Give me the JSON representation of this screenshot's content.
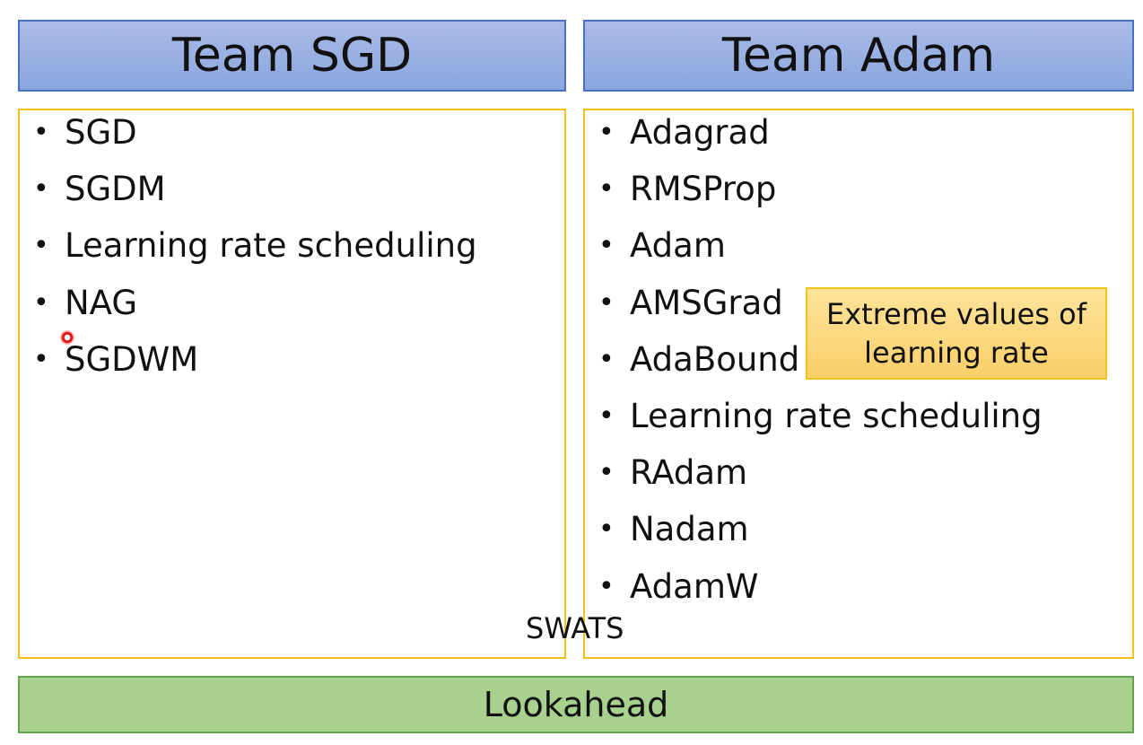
{
  "team_sgd": {
    "title": "Team SGD",
    "items": [
      "SGD",
      "SGDM",
      "Learning rate scheduling",
      "NAG",
      "SGDWM"
    ]
  },
  "team_adam": {
    "title": "Team Adam",
    "items": [
      "Adagrad",
      "RMSProp",
      "Adam",
      "AMSGrad",
      "AdaBound",
      "Learning rate scheduling",
      "RAdam",
      "Nadam",
      "AdamW"
    ]
  },
  "callout": {
    "text_line1": "Extreme values of",
    "text_line2": "learning rate"
  },
  "bridge_label": "SWATS",
  "footer": {
    "label": "Lookahead"
  },
  "bullet": "•",
  "colors": {
    "header_fill": "#8aa6df",
    "header_border": "#4a6fc4",
    "panel_border": "#f2c21a",
    "callout_fill": "#fbcf68",
    "footer_fill": "#a9d18e",
    "footer_border": "#62a34f",
    "pointer": "#e0161a"
  }
}
